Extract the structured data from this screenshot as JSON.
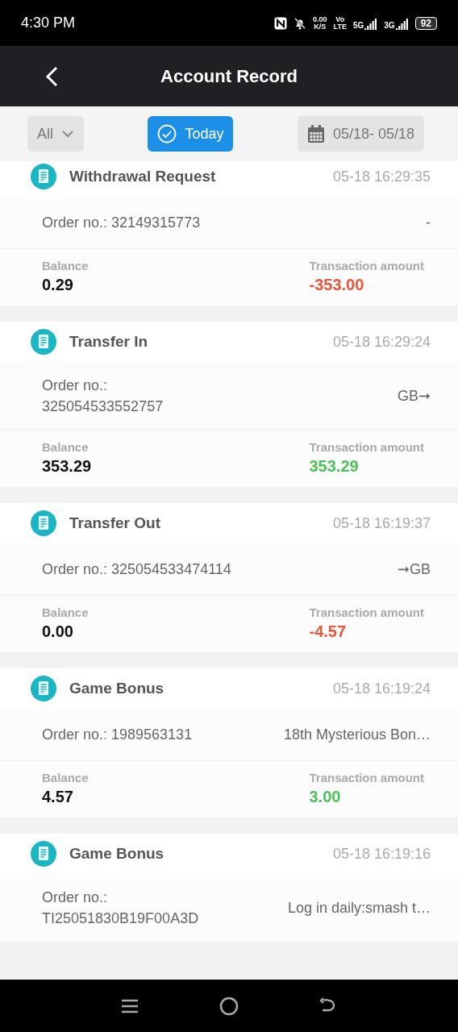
{
  "status_bar": {
    "time": "4:30 PM",
    "speed": "0.00",
    "speed_unit": "K/S",
    "volte_top": "Vo",
    "volte_bottom": "LTE",
    "network_1": "5G",
    "network_2": "3G",
    "battery": "92"
  },
  "header": {
    "title": "Account Record"
  },
  "filters": [
    {
      "kind": "dropdown",
      "label": "All",
      "selected": false
    },
    {
      "kind": "today",
      "label": "Today",
      "selected": true
    },
    {
      "kind": "date",
      "label": "05/18- 05/18",
      "selected": false
    }
  ],
  "records": [
    {
      "title": "Withdrawal Request",
      "time": "05-18 16:29:35",
      "order": "Order no.: 32149315773",
      "note": "-",
      "balance_label": "Balance",
      "balance": "0.29",
      "amount_label": "Transaction amount",
      "amount": "-353.00",
      "color": "#e8563a"
    },
    {
      "title": "Transfer In",
      "time": "05-18 16:29:24",
      "order": "Order no.: 325054533552757",
      "note": "GB➞",
      "balance_label": "Balance",
      "balance": "353.29",
      "amount_label": "Transaction amount",
      "amount": "353.29",
      "color": "#4cc15a"
    },
    {
      "title": "Transfer Out",
      "time": "05-18 16:19:37",
      "order": "Order no.: 325054533474114",
      "note": "➞GB",
      "balance_label": "Balance",
      "balance": "0.00",
      "amount_label": "Transaction amount",
      "amount": "-4.57",
      "color": "#e8563a"
    },
    {
      "title": "Game Bonus",
      "time": "05-18 16:19:24",
      "order": "Order no.: 1989563131",
      "note": "18th Mysterious Bon…",
      "balance_label": "Balance",
      "balance": "4.57",
      "amount_label": "Transaction amount",
      "amount": "3.00",
      "color": "#4cc15a"
    },
    {
      "title": "Game Bonus",
      "time": "05-18 16:19:16",
      "order": "Order no.: TI25051830B19F00A3D",
      "note": "Log in daily:smash t…"
    }
  ]
}
